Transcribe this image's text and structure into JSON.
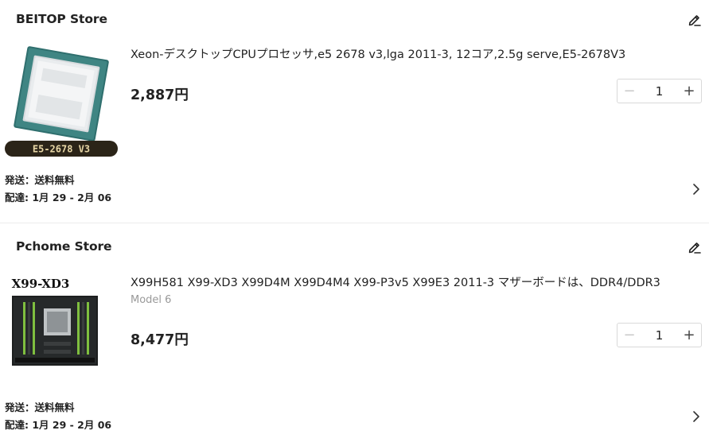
{
  "stores": [
    {
      "name": "BEITOP Store",
      "product": {
        "title": "Xeon-デスクトップCPUプロセッサ,e5 2678 v3,lga 2011-3, 12コア,2.5g serve,E5-2678V3",
        "image_label": "E5-2678 V3",
        "variant": "",
        "price": "2,887円",
        "quantity": "1",
        "shipping": "発送：送料無料",
        "delivery": "配達: 1月 29 - 2月 06"
      }
    },
    {
      "name": "Pchome Store",
      "product": {
        "title": "X99H581 X99-XD3 X99D4M X99D4M4 X99-P3v5 X99E3 2011-3 マザーボードは、DDR4/DDR3",
        "image_label": "X99-XD3",
        "variant": "Model 6",
        "price": "8,477円",
        "quantity": "1",
        "shipping": "発送：送料無料",
        "delivery": "配達: 1月 29 - 2月 06"
      }
    }
  ],
  "icons": {
    "edit": "pencil-icon",
    "minus": "minus-icon",
    "plus": "plus-icon",
    "chevron": "chevron-right-icon"
  },
  "stepper_symbols": {
    "minus": "−",
    "plus": "+"
  },
  "colors": {
    "text": "#222222",
    "muted": "#999999",
    "border": "#d9d9d9"
  }
}
